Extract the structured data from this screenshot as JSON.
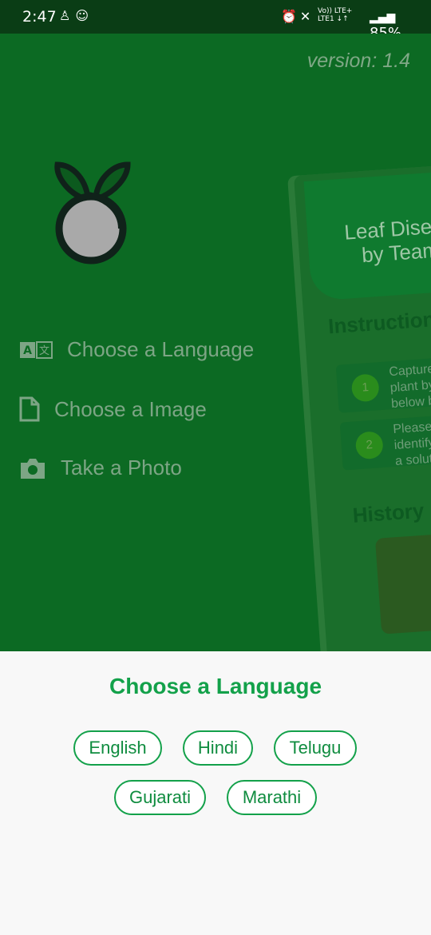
{
  "status_bar": {
    "time": "2:47",
    "battery": "85%",
    "network_top": "Vo)) LTE+",
    "network_bottom": "LTE1 ↓↑"
  },
  "app": {
    "version": "version: 1.4",
    "menu": [
      {
        "label": "Choose a Language",
        "icon": "translate-icon"
      },
      {
        "label": "Choose a Image",
        "icon": "file-icon"
      },
      {
        "label": "Take a Photo",
        "icon": "camera-icon"
      }
    ],
    "preview": {
      "title_line1": "Leaf Diseas",
      "title_line2": "by Team",
      "instructions_heading": "Instruction",
      "steps": [
        {
          "num": "1",
          "text": "Capture\nplant by\nbelow b"
        },
        {
          "num": "2",
          "text": "Please\nidentify\na solut"
        }
      ],
      "history_heading": "History"
    }
  },
  "language_sheet": {
    "title": "Choose a Language",
    "options": [
      "English",
      "Hindi",
      "Telugu",
      "Gujarati",
      "Marathi"
    ]
  },
  "colors": {
    "accent": "#13a14a",
    "backdrop": "#0c6a23",
    "status_bar": "#0a3d15"
  }
}
